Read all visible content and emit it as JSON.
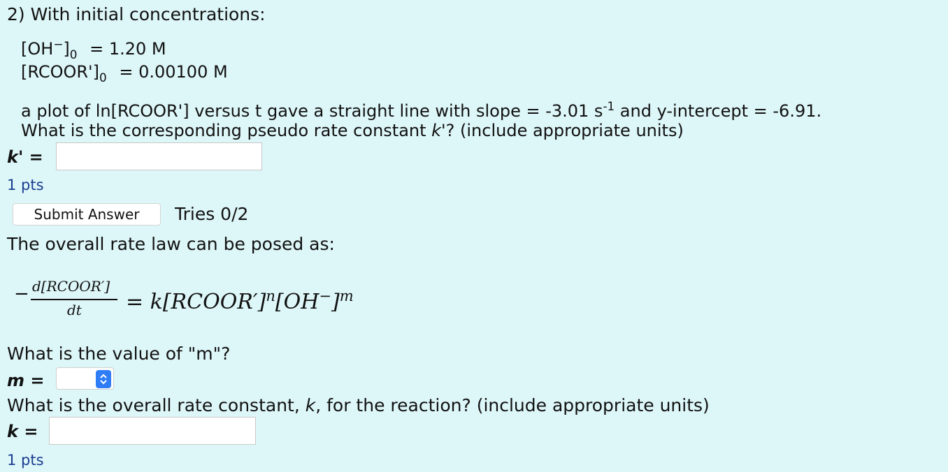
{
  "question": {
    "heading": "2) With initial concentrations:",
    "conc1": {
      "label": "[OH",
      "charge": "−",
      "close": "]",
      "sub": "0",
      "value": "= 1.20 M"
    },
    "conc2": {
      "label": "[RCOOR']",
      "sub": "0",
      "value": "= 0.00100 M"
    },
    "plot_line_a": "a plot of ln[RCOOR'] versus t gave a straight line with slope = -3.01 s",
    "plot_line_a_sup": "-1",
    "plot_line_b": " and y-intercept = -6.91.",
    "prompt1_pre": "What is the corresponding pseudo rate constant ",
    "prompt1_var": "k'",
    "prompt1_post": "? (include appropriate units)",
    "kprime_label": "k' =",
    "kprime_value": "",
    "pts1": "1 pts",
    "submit_label": "Submit Answer",
    "tries": "Tries 0/2",
    "rate_law_intro": "The overall rate law can be posed as:",
    "equation": {
      "minus": "−",
      "numerator": "d[RCOOR′]",
      "denominator": "dt",
      "rhs_a": "= k[RCOOR′]",
      "rhs_n": "n",
      "rhs_b": "[OH",
      "rhs_charge": "−",
      "rhs_c": "]",
      "rhs_m": "m"
    },
    "prompt2": "What is the value of \"m\"?",
    "m_label": "m =",
    "m_value": "",
    "prompt3_pre": "What is the overall rate constant, ",
    "prompt3_var": "k",
    "prompt3_post": ", for the reaction? (include appropriate units)",
    "k_label": "k =",
    "k_value": "",
    "pts2": "1 pts"
  },
  "icons": {
    "stepper": "updown-chevron-icon"
  },
  "colors": {
    "background": "#ddf6f8",
    "pts": "#1a3d8f",
    "stepper": "#2f7df6"
  }
}
